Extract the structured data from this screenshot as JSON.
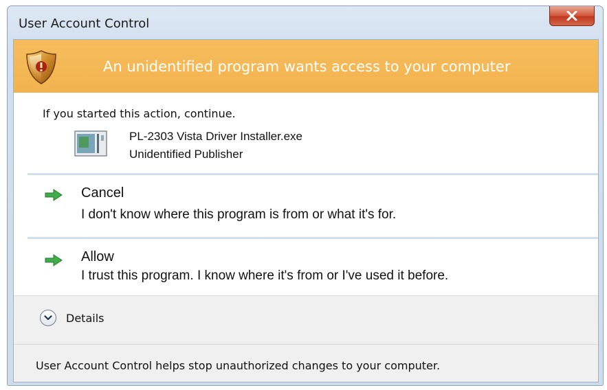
{
  "window": {
    "title": "User Account Control",
    "close_icon": "close-x-icon"
  },
  "banner": {
    "icon": "shield-warning-icon",
    "text": "An unidentified program wants access to your computer",
    "color": "#f4b753"
  },
  "intro": "If you started this action, continue.",
  "program": {
    "icon": "application-icon",
    "name": "PL-2303 Vista Driver Installer.exe",
    "publisher": "Unidentified Publisher"
  },
  "options": [
    {
      "icon": "green-arrow-icon",
      "title": "Cancel",
      "description": "I don't know where this program is from or what it's for."
    },
    {
      "icon": "green-arrow-icon",
      "title": "Allow",
      "description": "I trust this program. I know where it's from or I've used it before."
    }
  ],
  "details": {
    "icon": "chevron-down-icon",
    "label": "Details"
  },
  "footer": "User Account Control helps stop unauthorized changes to your computer."
}
